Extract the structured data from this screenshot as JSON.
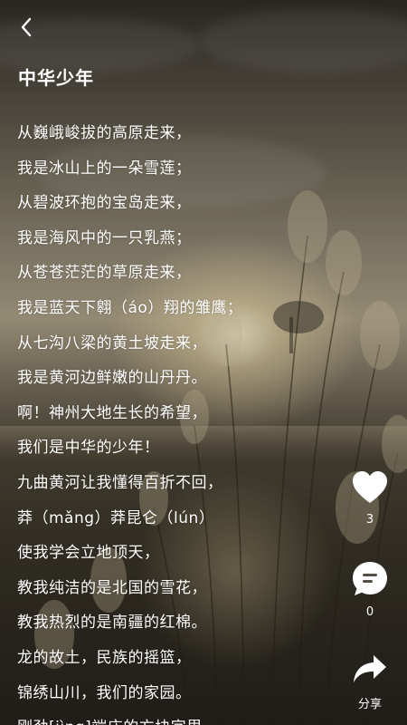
{
  "header": {
    "back_icon": "chevron-left-icon",
    "title": "中华少年"
  },
  "poem": {
    "lines": [
      "从巍峨峻拔的高原走来，",
      "我是冰山上的一朵雪莲；",
      "从碧波环抱的宝岛走来，",
      "我是海风中的一只乳燕；",
      "从苍苍茫茫的草原走来，",
      " 我是蓝天下翱（áo）翔的雏鹰；",
      "从七沟八梁的黄土坡走来，",
      "我是黄河边鲜嫩的山丹丹。",
      "啊！神州大地生长的希望，",
      "我们是中华的少年！",
      "九曲黄河让我懂得百折不回，",
      "莽（mǎng）莽昆仑（lún）",
      "使我学会立地顶天，",
      "教我纯洁的是北国的雪花，",
      "教我热烈的是南疆的红棉。",
      "龙的故土，民族的摇篮，",
      "锦绣山川，我们的家园。",
      "刚劲[jìng]端庄的方块字里"
    ]
  },
  "actions": {
    "like": {
      "icon": "heart-icon",
      "count": "3"
    },
    "comment": {
      "icon": "comment-icon",
      "count": "0"
    },
    "share": {
      "icon": "share-icon",
      "label": "分享"
    }
  },
  "colors": {
    "text": "#ffffff",
    "background_dark": "#2e2a22",
    "background_light": "#a89d84"
  }
}
